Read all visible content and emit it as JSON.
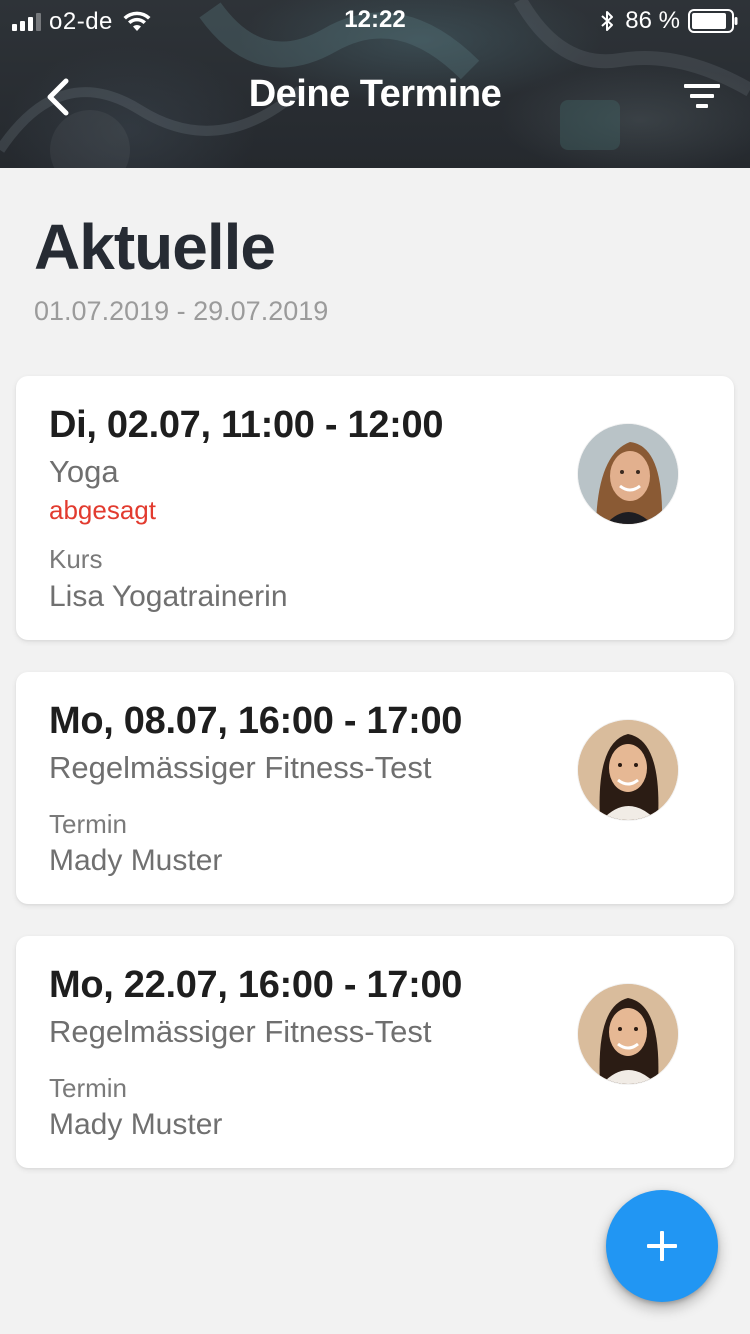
{
  "status_bar": {
    "carrier": "o2-de",
    "time": "12:22",
    "battery_percent": "86 %",
    "signal_bars_active": 3,
    "signal_bars_total": 4
  },
  "nav": {
    "title": "Deine Termine",
    "back_icon": "chevron-left-icon",
    "filter_icon": "filter-icon"
  },
  "section": {
    "title": "Aktuelle",
    "date_range": "01.07.2019 - 29.07.2019"
  },
  "appointments": [
    {
      "when": "Di, 02.07, 11:00 - 12:00",
      "service": "Yoga",
      "status": "abgesagt",
      "kind": "Kurs",
      "person": "Lisa Yogatrainerin"
    },
    {
      "when": "Mo, 08.07, 16:00 - 17:00",
      "service": "Regelmässiger Fitness-Test",
      "status": "",
      "kind": "Termin",
      "person": "Mady Muster"
    },
    {
      "when": "Mo, 22.07, 16:00 - 17:00",
      "service": "Regelmässiger Fitness-Test",
      "status": "",
      "kind": "Termin",
      "person": "Mady Muster"
    }
  ],
  "fab": {
    "icon": "plus-icon"
  },
  "colors": {
    "header_bg": "#2a2f34",
    "page_bg": "#f2f2f2",
    "status_cancelled": "#e23b2f",
    "fab_blue": "#2196f3",
    "title_text": "#262b33"
  }
}
